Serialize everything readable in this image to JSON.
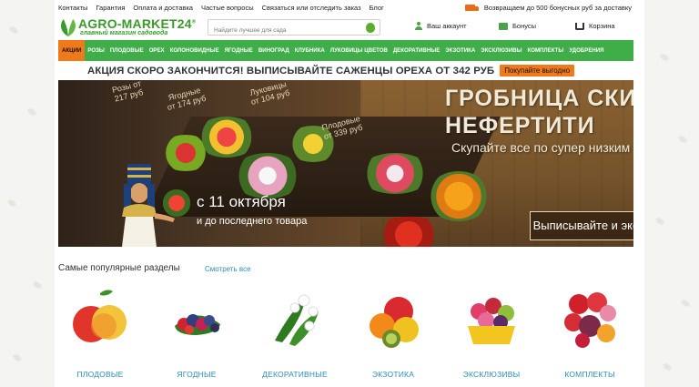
{
  "top_links": [
    "Контакты",
    "Гарантия",
    "Оплата и доставка",
    "Частые вопросы",
    "Связаться или отследить заказ",
    "Блог"
  ],
  "bonus_note": "Возвращаем до 500 бонусных руб за доставку",
  "logo": {
    "title": "AGRO-MARKET24",
    "registered": "®",
    "subtitle": "главный магазин садовода"
  },
  "search": {
    "placeholder": "Найдите лучшее для сада"
  },
  "header": {
    "account": "Ваш аккаунт",
    "bonuses": "Бонусы",
    "cart": "Корзина"
  },
  "nav": [
    "АКЦИИ",
    "РОЗЫ",
    "ПЛОДОВЫЕ",
    "ОРЕХ",
    "КОЛОНОВИДНЫЕ",
    "ЯГОДНЫЕ",
    "ВИНОГРАД",
    "КЛУБНИКА",
    "ЛУКОВИЦЫ ЦВЕТОВ",
    "ДЕКОРАТИВНЫЕ",
    "ЭКЗОТИКА",
    "ЭКСКЛЮЗИВЫ",
    "КОМПЛЕКТЫ",
    "УДОБРЕНИЯ"
  ],
  "promo": {
    "text": "АКЦИЯ СКОРО ЗАКОНЧИТСЯ! ВЫПИСЫВАЙТЕ САЖЕНЦЫ ОРЕХА ОТ 342 РУБ",
    "button": "Покупайте выгодно"
  },
  "banner": {
    "headline_line1": "ГРОБНИЦА СКИДОК",
    "headline_line2": "НЕФЕРТИТИ",
    "subline": "Скупайте все по супер низким ценам",
    "date_big": "с 11 октября",
    "date_small": "и до последнего товара",
    "cta": "Выписывайте и экономьте",
    "tags": [
      {
        "line1": "Розы от",
        "line2": "217 руб"
      },
      {
        "line1": "Ягодные",
        "line2": "от 174 руб"
      },
      {
        "line1": "Луковицы",
        "line2": "от 104 руб"
      },
      {
        "line1": "Плодовые",
        "line2": "от 339 руб"
      }
    ]
  },
  "popular": {
    "title": "Самые популярные разделы",
    "see_all": "Смотреть все",
    "categories": [
      "ПЛОДОВЫЕ",
      "ЯГОДНЫЕ",
      "ДЕКОРАТИВНЫЕ",
      "ЭКЗОТИКА",
      "ЭКСКЛЮЗИВЫ",
      "КОМПЛЕКТЫ"
    ]
  },
  "colors": {
    "brand_green": "#3fae49",
    "accent_orange": "#f07a1a",
    "link_blue": "#2b8fb4"
  }
}
